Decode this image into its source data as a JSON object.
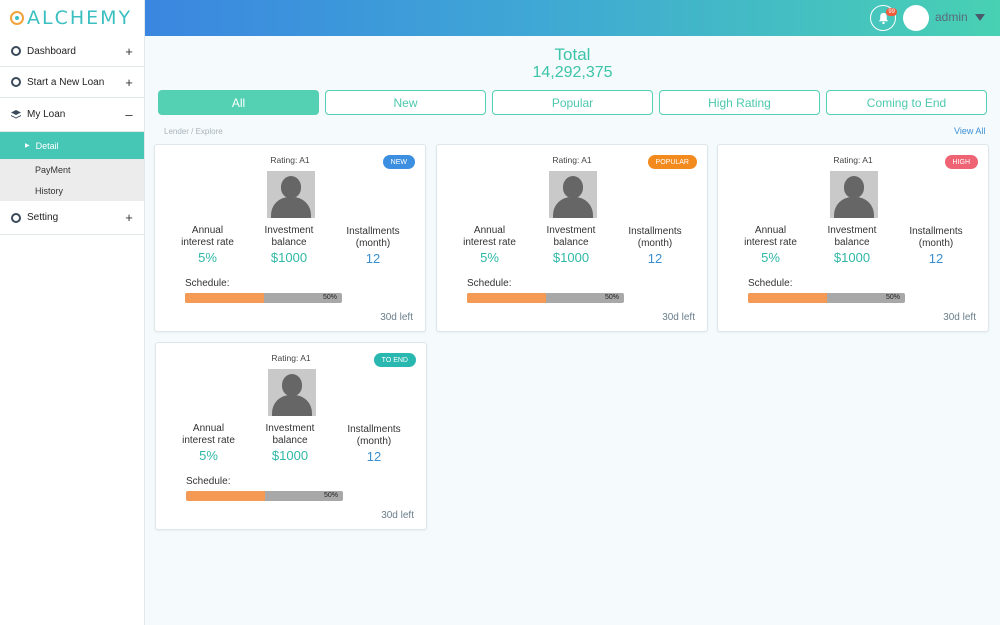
{
  "app": {
    "logo_text": "ALCHEMY"
  },
  "sidebar": {
    "items": [
      {
        "label": "Dashboard",
        "toggle": "+"
      },
      {
        "label": "Start a New Loan",
        "toggle": "+"
      },
      {
        "label": "My Loan",
        "toggle": "–"
      },
      {
        "label": "Setting",
        "toggle": "+"
      }
    ],
    "subitems": [
      {
        "label": "Detail",
        "active": true
      },
      {
        "label": "PayMent"
      },
      {
        "label": "History"
      }
    ]
  },
  "header": {
    "notification_count": "99",
    "username": "admin"
  },
  "summary": {
    "total_label": "Total",
    "total_value": "14,292,375"
  },
  "tabs": [
    "All",
    "New",
    "Popular",
    "High Rating",
    "Coming to End"
  ],
  "breadcrumb": "Lender / Explore",
  "view_all": "View All",
  "labels": {
    "annual": "Annual interest rate",
    "balance": "Investment balance",
    "installments": "Installments (month)",
    "schedule": "Schedule:"
  },
  "cards": [
    {
      "rating": "Rating: A1",
      "tag": "NEW",
      "tag_color": "#3c8fe0",
      "rate": "5%",
      "balance": "$1000",
      "installments": "12",
      "progress": 0.5,
      "progress_text": "50%",
      "days_left": "30d left"
    },
    {
      "rating": "Rating: A1",
      "tag": "POPULAR",
      "tag_color": "#f38a1e",
      "rate": "5%",
      "balance": "$1000",
      "installments": "12",
      "progress": 0.5,
      "progress_text": "50%",
      "days_left": "30d left"
    },
    {
      "rating": "Rating: A1",
      "tag": "HIGH",
      "tag_color": "#ee6475",
      "rate": "5%",
      "balance": "$1000",
      "installments": "12",
      "progress": 0.5,
      "progress_text": "50%",
      "days_left": "30d left"
    },
    {
      "rating": "Rating: A1",
      "tag": "TO END",
      "tag_color": "#28b8b0",
      "rate": "5%",
      "balance": "$1000",
      "installments": "12",
      "progress": 0.5,
      "progress_text": "50%",
      "days_left": "30d left"
    }
  ]
}
